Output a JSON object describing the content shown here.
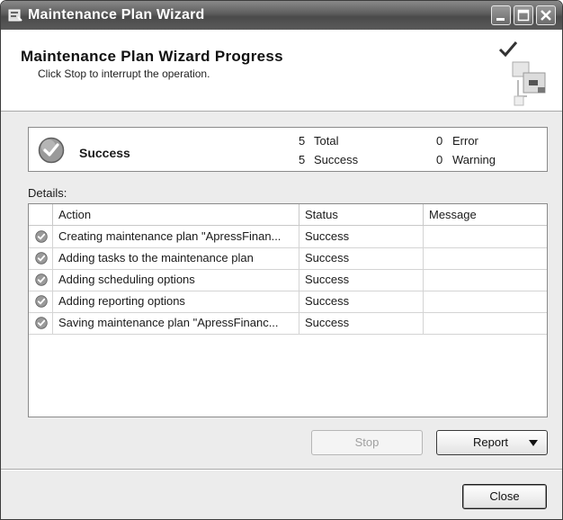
{
  "window": {
    "title": "Maintenance Plan Wizard"
  },
  "header": {
    "title": "Maintenance Plan Wizard Progress",
    "subtitle": "Click Stop to interrupt the operation."
  },
  "summary": {
    "status": "Success",
    "total_count": "5",
    "total_label": "Total",
    "success_count": "5",
    "success_label": "Success",
    "error_count": "0",
    "error_label": "Error",
    "warning_count": "0",
    "warning_label": "Warning"
  },
  "details": {
    "label": "Details:",
    "columns": [
      "Action",
      "Status",
      "Message"
    ],
    "rows": [
      {
        "action": "Creating maintenance plan \"ApressFinan...",
        "status": "Success",
        "message": ""
      },
      {
        "action": "Adding tasks to the maintenance plan",
        "status": "Success",
        "message": ""
      },
      {
        "action": "Adding scheduling options",
        "status": "Success",
        "message": ""
      },
      {
        "action": "Adding reporting options",
        "status": "Success",
        "message": ""
      },
      {
        "action": "Saving maintenance plan \"ApressFinanc...",
        "status": "Success",
        "message": ""
      }
    ]
  },
  "buttons": {
    "stop": "Stop",
    "report": "Report",
    "close": "Close"
  },
  "colors": {
    "titlebar": "#5c5c5c",
    "success_icon": "#8c8c8c"
  },
  "icons": {
    "window": "wizard-app-icon",
    "minimize": "minimize-icon",
    "maximize": "maximize-icon",
    "close": "close-icon",
    "status": "success-check-icon",
    "row_status": "success-check-icon",
    "report_dropdown": "chevron-down-icon"
  }
}
